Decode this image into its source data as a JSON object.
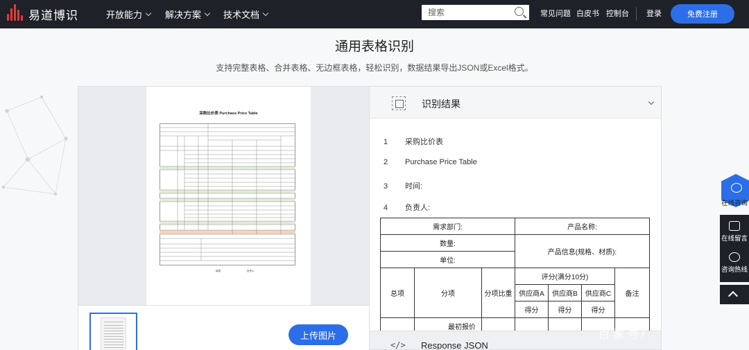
{
  "nav": {
    "brand": "易道博识",
    "menu": [
      "开放能力",
      "解决方案",
      "技术文档"
    ],
    "search_placeholder": "搜索",
    "links": [
      "常见问题",
      "白皮书",
      "控制台"
    ],
    "login": "登录",
    "signup": "免费注册"
  },
  "page": {
    "title": "通用表格识别",
    "subtitle": "支持完整表格、合并表格、无边框表格，轻松识别，数据结果导出JSON或Excel格式。"
  },
  "document": {
    "title": "采购比价表  Purchase Price Table",
    "sign_left": "填表:",
    "sign_right": "负责人:"
  },
  "upload_label": "上传图片",
  "result": {
    "header": "识别结果",
    "lines": [
      {
        "n": "1",
        "text": "采购比价表"
      },
      {
        "n": "2",
        "text": "Purchase Price Table"
      },
      {
        "n": "3",
        "text": "时间:"
      },
      {
        "n": "4",
        "text": "负责人:"
      }
    ],
    "table": {
      "dept": "需求部门:",
      "product_name": "产品名称:",
      "qty": "数量:",
      "product_info": "产品信息(规格、材质):",
      "unit": "单位:",
      "score": "评分(满分10分)",
      "total": "总项",
      "sub": "分项",
      "weight": "分项比重",
      "sa": "供应商A",
      "sb": "供应商B",
      "sc": "供应商C",
      "remark": "备注",
      "score_a": "得分",
      "score_b": "得分",
      "score_c": "得分",
      "lowest": "最初报价"
    },
    "json_icon": "</>",
    "json_label": "Response JSON"
  },
  "side": {
    "consult": "在线咨询",
    "message": "在线留言",
    "hotline": "咨询热线"
  },
  "watermark": "百家号/"
}
